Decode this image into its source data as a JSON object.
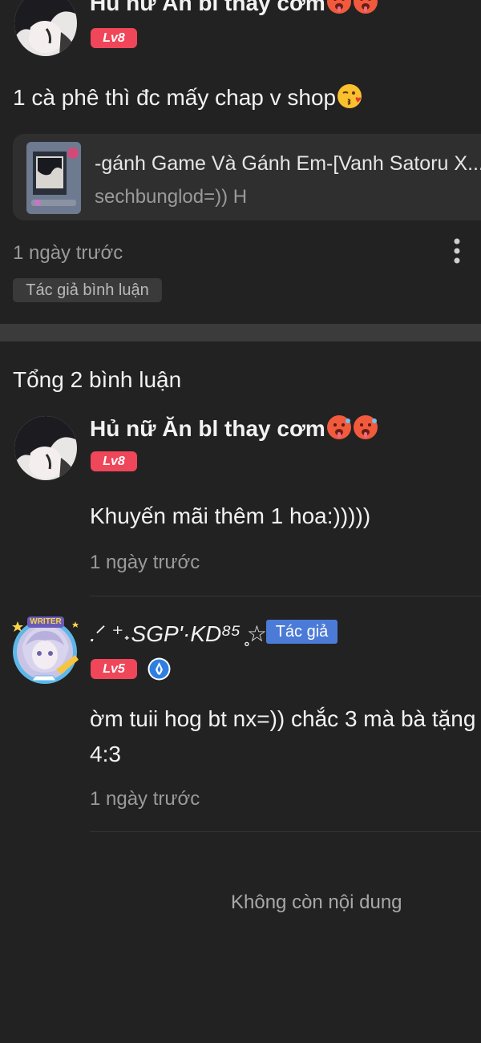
{
  "top_comment": {
    "username": "Hủ nữ Ăn bl thay cơm",
    "username_emojis": [
      "hot-face-emoji",
      "hot-face-emoji"
    ],
    "level": "Lv8",
    "content": "1 cà phê thì đc mấy chap v shop",
    "content_emoji": "kissing-face-emoji",
    "story": {
      "title": "-gánh Game Và Gánh Em-[Vanh Satoru X...",
      "subtitle": "sechbunglod=)) H"
    },
    "time": "1 ngày trước",
    "author_tag": "Tác giả bình luận"
  },
  "replies_header": "Tổng 2 bình luận",
  "replies": [
    {
      "username": "Hủ nữ Ăn bl thay cơm",
      "username_emojis": [
        "hot-face-emoji",
        "hot-face-emoji"
      ],
      "level": "Lv8",
      "content": "Khuyến mãi thêm 1 hoa:)))))",
      "time": "1 ngày trước"
    },
    {
      "avatar_frame_label": "WRITER",
      "username": ".ᐟ ⁺˖SGP'·KD⁸⁵ ̥☆",
      "author_badge": "Tác giả",
      "level": "Lv5",
      "content_line1": "ờm tuii hog bt nx=)) chắc 3 mà bà tặng",
      "content_line2": "4:3",
      "time": "1 ngày trước"
    }
  ],
  "footer_text": "Không còn nội dung",
  "colors": {
    "background": "#222222",
    "level_badge": "#f0465a",
    "author_badge": "#4b7bd6",
    "card": "#2f2f2f"
  }
}
